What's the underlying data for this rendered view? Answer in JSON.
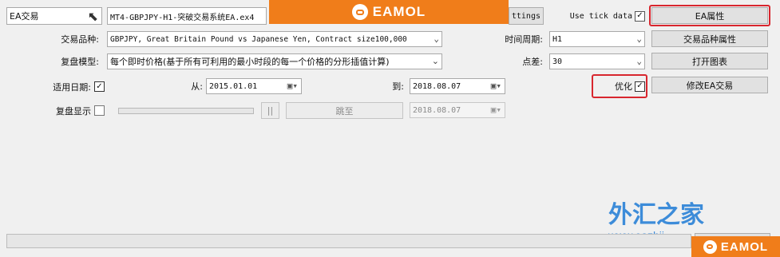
{
  "top": {
    "expert_type": "EA交易",
    "expert_file": "MT4-GBPJPY-H1-突破交易系统EA.ex4",
    "settings_label": "ttings",
    "use_tick_label": "Use tick data",
    "ea_props_label": "EA属性"
  },
  "row1": {
    "symbol_label": "交易品种:",
    "symbol_value": "GBPJPY, Great Britain Pound vs Japanese Yen, Contract size100,000",
    "period_label": "时间周期:",
    "period_value": "H1",
    "symbol_props_label": "交易品种属性"
  },
  "row2": {
    "model_label": "复盘模型:",
    "model_value": "每个即时价格(基于所有可利用的最小时段的每一个价格的分形插值计算)",
    "spread_label": "点差:",
    "spread_value": "30",
    "open_chart_label": "打开图表"
  },
  "row3": {
    "use_date_label": "适用日期:",
    "from_label": "从:",
    "from_date": "2015.01.01",
    "to_label": "到:",
    "to_date": "2018.08.07",
    "optimize_label": "优化",
    "modify_ea_label": "修改EA交易"
  },
  "row4": {
    "visual_label": "复盘显示",
    "pause_label": "||",
    "skip_label": "跳至",
    "skip_date": "2018.08.07"
  },
  "overlay": {
    "eamol_logo": "EAMOL",
    "watermark_cn": "外汇之家",
    "watermark_url": "www.eazhij"
  },
  "colors": {
    "highlight": "#d8262e",
    "eamol_bar": "#f07d1a",
    "watermark": "#1e7bd6"
  },
  "icons": {
    "cursor": "mouse-pointer-icon",
    "calendar": "calendar-icon",
    "checkmark": "checkmark-icon"
  }
}
